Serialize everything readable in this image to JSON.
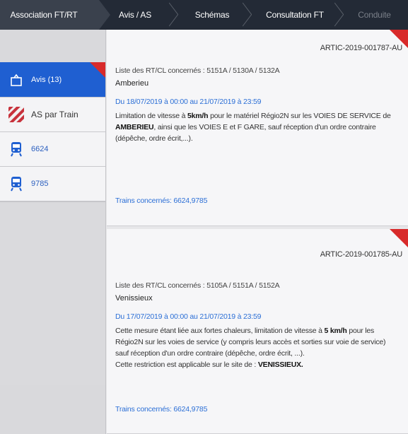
{
  "nav": {
    "tabs": [
      {
        "label": "Association FT/RT"
      },
      {
        "label": "Avis / AS"
      },
      {
        "label": "Schémas"
      },
      {
        "label": "Consultation FT"
      },
      {
        "label": "Conduite"
      }
    ]
  },
  "sidebar": {
    "items": [
      {
        "label": "Avis (13)",
        "icon": "document-icon"
      },
      {
        "label": "AS par Train",
        "icon": "hatched-square-icon"
      },
      {
        "label": "6624",
        "icon": "train-icon"
      },
      {
        "label": "9785",
        "icon": "train-icon"
      }
    ]
  },
  "notices": [
    {
      "reference": "ARTIC-2019-001787-AU",
      "lines": "Liste des RT/CL concernés : 5151A / 5130A / 5132A",
      "place": "Amberieu",
      "dates": "Du 18/07/2019 à 00:00 au 21/07/2019 à 23:59",
      "desc": {
        "p1": "Limitation de vitesse à ",
        "b1": "5km/h",
        "p2": " pour le matériel Régio2N sur les VOIES DE SERVICE de ",
        "b2": "AMBERIEU",
        "p3": ", ainsi que les VOIES E et F GARE, sauf réception d'un ordre contraire (dépêche, ordre écrit,...)."
      },
      "trains": "Trains concernés: 6624,9785"
    },
    {
      "reference": "ARTIC-2019-001785-AU",
      "lines": "Liste des RT/CL concernés : 5105A / 5151A / 5152A",
      "place": "Venissieux",
      "dates": "Du 17/07/2019 à 00:00 au 21/07/2019 à 23:59",
      "desc": {
        "p1": "Cette mesure étant liée aux fortes chaleurs, limitation de vitesse à ",
        "b1": "5 km/h",
        "p2": " pour les Régio2N sur les voies de service (y compris leurs accès et sorties sur voie de service) sauf réception d'un ordre contraire (dépêche, ordre écrit, ...).",
        "p3": "Cette restriction est applicable sur le site de : ",
        "b2": "VENISSIEUX."
      },
      "trains": "Trains concernés: 6624,9785"
    }
  ],
  "colors": {
    "nav_bg": "#232a36",
    "active_blue": "#1f5fd1",
    "link_blue": "#2c6fd6",
    "flag_red": "#d82a2a"
  }
}
